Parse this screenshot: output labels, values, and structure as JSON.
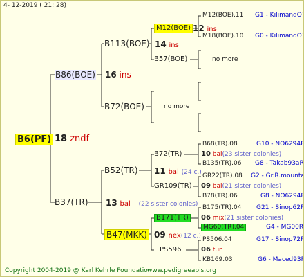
{
  "timestamp": "4- 12-2019 ( 21: 28)",
  "root": {
    "name": "B6(PF)",
    "number": "18",
    "race": "zndf"
  },
  "gen1": [
    {
      "name": "B86(BOE)",
      "number": "16",
      "race": "ins"
    },
    {
      "name": "B37(TR)",
      "number": "13",
      "race": "bal",
      "siblings": "(22 sister colonies)"
    }
  ],
  "gen2": [
    {
      "name": "B113(BOE)",
      "number": "14",
      "race": "ins"
    },
    {
      "name": "B72(BOE)",
      "note": "no more"
    },
    {
      "name": "B52(TR)",
      "number": "11",
      "race": "bal",
      "siblings": "(24 c.)"
    },
    {
      "name": "B47(MKK)",
      "number": "09",
      "race": "nex",
      "siblings": "(12 c.)"
    }
  ],
  "gen3": [
    {
      "name": "M12(BOE)",
      "number": "12",
      "race": "ins"
    },
    {
      "name": "B57(BOE)",
      "note": "no more"
    },
    {
      "name": "B72(TR)",
      "number": "10",
      "race": "bal",
      "siblings": "(23 sister colonies)"
    },
    {
      "name": "GR109(TR)",
      "number": "09",
      "race": "bal",
      "siblings": "(21 sister colonies)"
    },
    {
      "name": "B171(TR)",
      "number": "06",
      "race": "mix",
      "siblings": "(21 sister colonies)"
    },
    {
      "name": "PS596",
      "number": "06",
      "race": "tun"
    }
  ],
  "gen4": [
    {
      "name": "M12(BOE).11",
      "code": "G1 - KilimandO1"
    },
    {
      "name": "M18(BOE).10",
      "code": "G0 - KilimandO1"
    },
    {
      "name": "B68(TR).08",
      "code": "G10 - NO6294R"
    },
    {
      "name": "B135(TR).06",
      "code": "G8 - Takab93aR"
    },
    {
      "name": "GR22(TR).08",
      "code": "G2 - Gr.R.mounta"
    },
    {
      "name": "B78(TR).06",
      "code": "G8 - NO6294R"
    },
    {
      "name": "B175(TR).04",
      "code": "G21 - Sinop62R"
    },
    {
      "name": "MG60(TR).04",
      "code": "G4 - MG00R"
    },
    {
      "name": "PS506.04",
      "code": "G17 - Sinop72R"
    },
    {
      "name": "KB169.03",
      "code": "G6 - Maced93R"
    }
  ],
  "footer": {
    "copyright": "Copyright 2004-2019 @ Karl Kehrle Foundation",
    "site": "www.pedigreeapis.org"
  },
  "colors": {
    "background": "#ffffe8",
    "highlight_yellow": "#ffff00",
    "highlight_green": "#22dd22",
    "race_red": "#cc0000",
    "code_blue": "#0000cc",
    "footer_green": "#107010"
  }
}
